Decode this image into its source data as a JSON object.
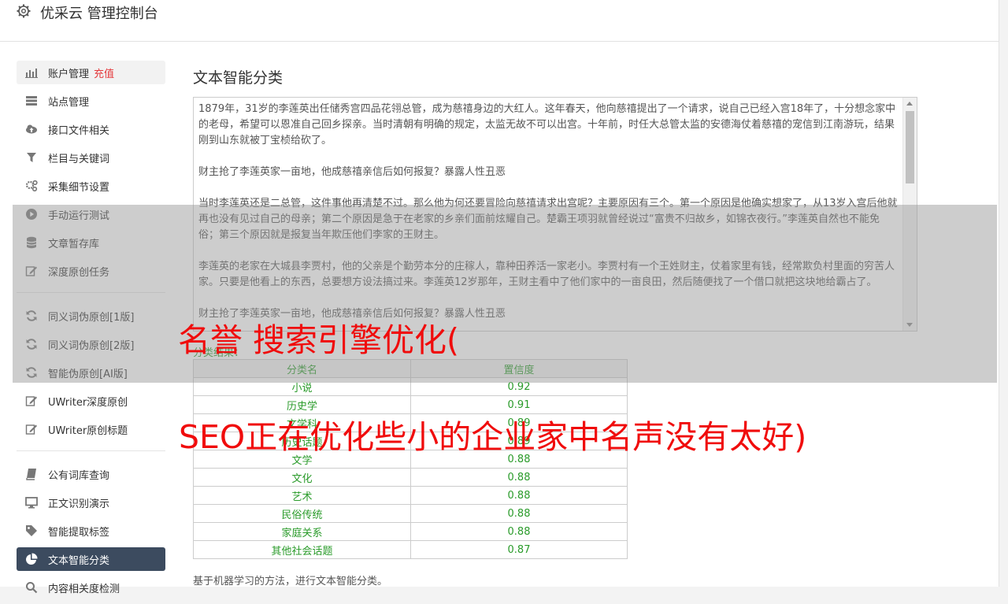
{
  "header": {
    "title": "优采云 管理控制台",
    "icon": "gear-icon"
  },
  "sidebar": {
    "groups": [
      [
        {
          "label": "账户管理",
          "extra": "充值",
          "icon": "bar-chart-icon",
          "state": "hover"
        },
        {
          "label": "站点管理",
          "icon": "server-icon"
        },
        {
          "label": "接口文件相关",
          "icon": "cloud-upload-icon"
        },
        {
          "label": "栏目与关键词",
          "icon": "filter-icon"
        },
        {
          "label": "采集细节设置",
          "icon": "gears-icon"
        },
        {
          "label": "手动运行测试",
          "icon": "play-circle-icon"
        },
        {
          "label": "文章暂存库",
          "icon": "database-icon"
        },
        {
          "label": "深度原创任务",
          "icon": "edit-icon"
        }
      ],
      [
        {
          "label": "同义词伪原创[1版]",
          "icon": "refresh-icon"
        },
        {
          "label": "同义词伪原创[2版]",
          "icon": "refresh-icon"
        },
        {
          "label": "智能伪原创[AI版]",
          "icon": "refresh-icon"
        },
        {
          "label": "UWriter深度原创",
          "icon": "edit-icon"
        },
        {
          "label": "UWriter原创标题",
          "icon": "edit-icon"
        }
      ],
      [
        {
          "label": "公有词库查询",
          "icon": "book-icon"
        },
        {
          "label": "正文识别演示",
          "icon": "desktop-icon"
        },
        {
          "label": "智能提取标签",
          "icon": "tag-icon"
        },
        {
          "label": "文本智能分类",
          "icon": "pie-chart-icon",
          "state": "active"
        },
        {
          "label": "内容相关度检测",
          "icon": "search-icon"
        }
      ]
    ]
  },
  "main": {
    "title": "文本智能分类",
    "article": "1879年，31岁的李莲英出任储秀宫四品花翎总管，成为慈禧身边的大红人。这年春天，他向慈禧提出了一个请求，说自己已经入宫18年了，十分想念家中的老母，希望可以恩准自己回乡探亲。当时清朝有明确的规定，太监无故不可以出宫。十年前，时任大总管太监的安德海仗着慈禧的宠信到江南游玩，结果刚到山东就被丁宝桢给砍了。\n\n财主抢了李莲英家一亩地，他成慈禧亲信后如何报复？暴露人性丑恶\n\n当时李莲英还是二总管，这件事他再清楚不过。那么他为何还要冒险向慈禧请求出宫呢？主要原因有三个。第一个原因是他确实想家了，从13岁入宫后他就再也没有见过自己的母亲；第二个原因是急于在老家的乡亲们面前炫耀自己。楚霸王项羽就曾经说过“富贵不归故乡，如锦衣夜行。”李莲英自然也不能免俗；第三个原因就是报复当年欺压他们李家的王财主。\n\n李莲英的老家在大城县李贾村，他的父亲是个勤劳本分的庄稼人，靠种田养活一家老小。李贾村有一个王姓财主，仗着家里有钱，经常欺负村里面的穷苦人家。只要是他看上的东西，总要想方设法搞过来。李莲英12岁那年，王财主看中了他们家中的一亩良田，然后随便找了一个借口就把这块地给霸占了。\n\n财主抢了李莲英家一亩地，他成慈禧亲信后如何报复？暴露人性丑恶",
    "result_label": "分类结果：",
    "table": {
      "headers": [
        "分类名",
        "置信度"
      ],
      "rows": [
        [
          "小说",
          "0.92"
        ],
        [
          "历史学",
          "0.91"
        ],
        [
          "文学科",
          "0.89"
        ],
        [
          "历史话题",
          "0.89"
        ],
        [
          "文学",
          "0.88"
        ],
        [
          "文化",
          "0.88"
        ],
        [
          "艺术",
          "0.88"
        ],
        [
          "民俗传统",
          "0.88"
        ],
        [
          "家庭关系",
          "0.88"
        ],
        [
          "其他社会话题",
          "0.87"
        ]
      ]
    },
    "footnote": "基于机器学习的方法，进行文本智能分类。"
  },
  "watermark": {
    "line1": "名誉 搜索引擎优化(",
    "line2": "SEO正在优化些小的企业家中名声没有太好)",
    "color": "#f00c0c"
  },
  "colors": {
    "active_bg": "#3c4b5f",
    "green": "#2a9b2a",
    "recharge": "#e4393c"
  }
}
